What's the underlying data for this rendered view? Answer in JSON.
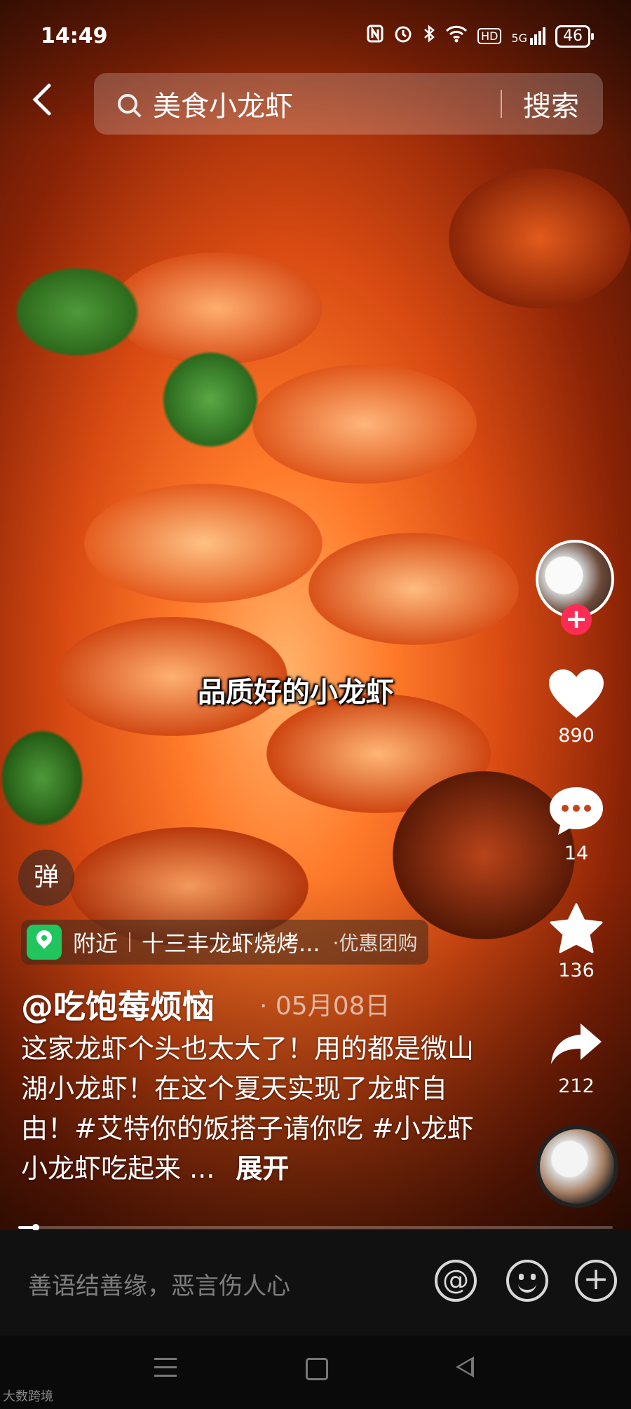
{
  "status_bar": {
    "time": "14:49",
    "icons": [
      "nfc-icon",
      "alarm-icon",
      "bluetooth-icon",
      "wifi-icon",
      "hd-icon",
      "signal-5g-icon"
    ],
    "hd_label": "HD",
    "net_label": "5G",
    "battery": "46"
  },
  "search": {
    "query": "美食小龙虾",
    "button_label": "搜索"
  },
  "video": {
    "caption": "品质好的小龙虾",
    "progress": 0.03
  },
  "actions": {
    "likes": "890",
    "comments": "14",
    "favorites": "136",
    "shares": "212"
  },
  "danmu_label": "弹",
  "poi": {
    "nearby_label": "附近",
    "shop_name": "十三丰龙虾烧烤...",
    "deal_label": "·优惠团购"
  },
  "post": {
    "author": "@吃饱莓烦恼",
    "date": "· 05月08日",
    "description": "这家龙虾个头也太大了！用的都是微山湖小龙虾！在这个夏天实现了龙虾自由！#艾特你的饭搭子请你吃 #小龙虾小龙虾吃起来 ...",
    "expand_label": "展开"
  },
  "comment_bar": {
    "placeholder": "善语结善缘，恶言伤人心",
    "at_label": "@",
    "plus_label": "+"
  },
  "watermark": "大数跨境",
  "colors": {
    "like_accent": "#fe2c55",
    "poi_pin": "#20c55e"
  }
}
